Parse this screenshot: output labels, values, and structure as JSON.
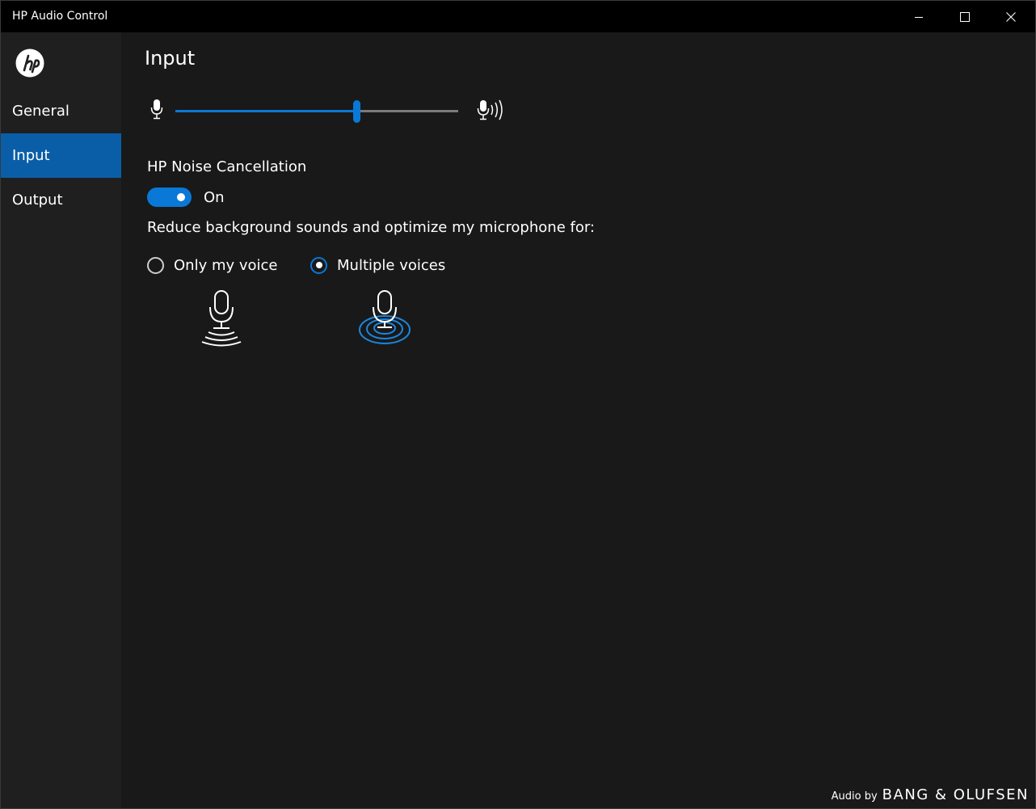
{
  "window": {
    "title": "HP Audio Control"
  },
  "sidebar": {
    "items": [
      {
        "label": "General",
        "active": false
      },
      {
        "label": "Input",
        "active": true
      },
      {
        "label": "Output",
        "active": false
      }
    ]
  },
  "main": {
    "title": "Input",
    "volume": {
      "level": 0.64
    },
    "noise_cancellation": {
      "label": "HP Noise Cancellation",
      "toggle_state": "On",
      "enabled": true
    },
    "optimize": {
      "description": "Reduce background sounds and optimize my microphone for:",
      "options": [
        {
          "label": "Only my voice",
          "selected": false,
          "icon": "mic-single-voice-icon"
        },
        {
          "label": "Multiple voices",
          "selected": true,
          "icon": "mic-multiple-voices-icon"
        }
      ]
    }
  },
  "footer": {
    "prefix": "Audio by",
    "brand": "BANG & OLUFSEN"
  },
  "colors": {
    "accent": "#0a78d7",
    "nav_active": "#0a5ea8",
    "background": "#191919",
    "titlebar": "#000000"
  }
}
